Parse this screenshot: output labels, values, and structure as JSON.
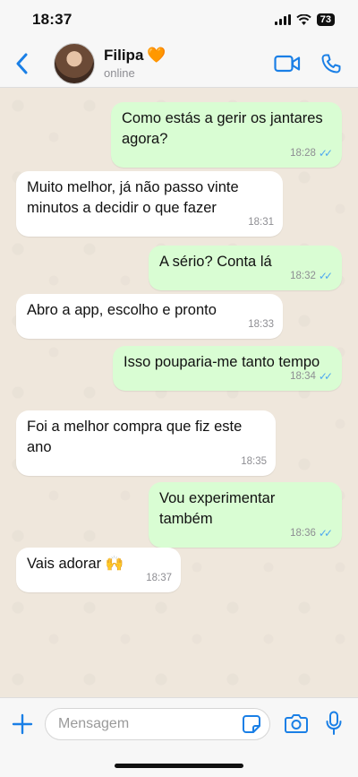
{
  "status_bar": {
    "time": "18:37",
    "battery": "73"
  },
  "header": {
    "contact_name": "Filipa",
    "contact_emoji": "🧡",
    "contact_status": "online"
  },
  "messages": [
    {
      "direction": "out",
      "text": "Como estás a gerir os jantares agora?",
      "time": "18:28",
      "read": true
    },
    {
      "direction": "in",
      "text": "Muito melhor, já não passo vinte minutos a decidir o que fazer",
      "time": "18:31"
    },
    {
      "direction": "out",
      "text": "A sério? Conta lá",
      "time": "18:32",
      "read": true
    },
    {
      "direction": "in",
      "text": "Abro a app, escolho e pronto",
      "time": "18:33"
    },
    {
      "direction": "out",
      "text": "Isso pouparia-me tanto tempo",
      "time": "18:34",
      "read": true
    },
    {
      "direction": "in",
      "text": "Foi a melhor compra que fiz este ano",
      "time": "18:35"
    },
    {
      "direction": "out",
      "text": "Vou experimentar também",
      "time": "18:36",
      "read": true
    },
    {
      "direction": "in",
      "text": "Vais adorar 🙌",
      "time": "18:37"
    }
  ],
  "input": {
    "placeholder": "Mensagem",
    "value": ""
  },
  "colors": {
    "accent": "#1a7fe6",
    "outgoing_bubble": "#d9fdd3",
    "incoming_bubble": "#ffffff",
    "read_ticks": "#4fa8ef"
  }
}
